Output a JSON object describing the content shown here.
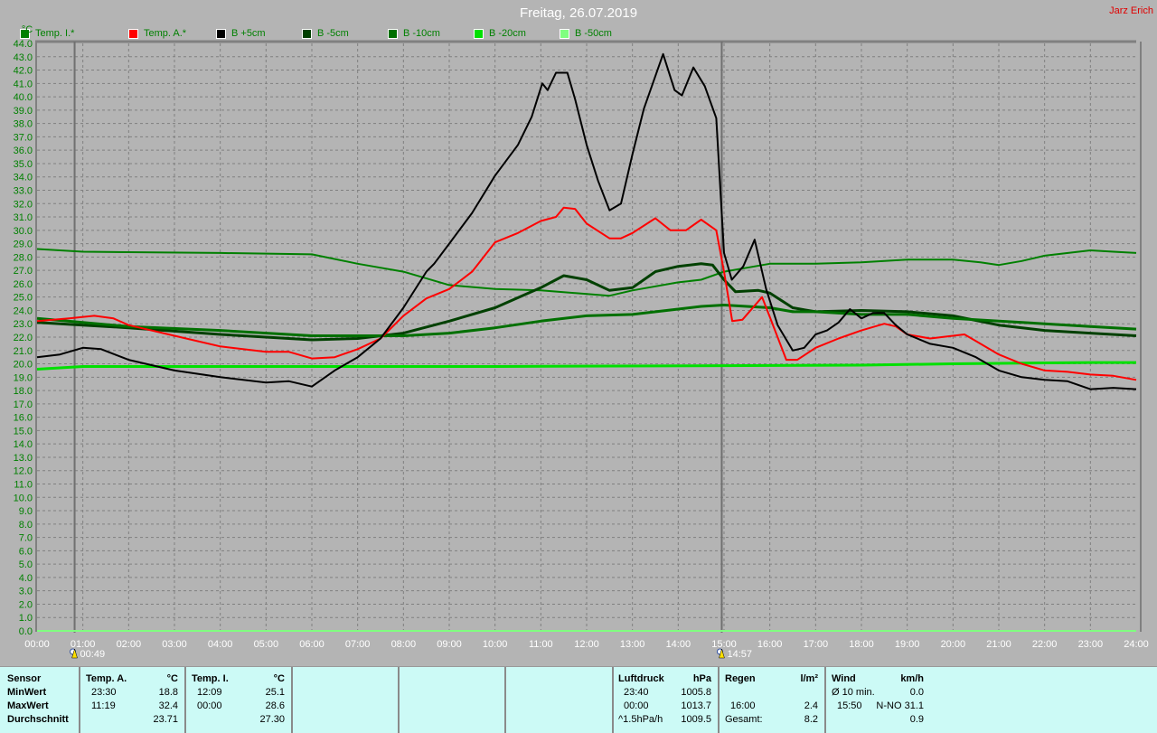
{
  "header": {
    "title": "Freitag, 26.07.2019",
    "author": "Jarz Erich"
  },
  "legend": [
    {
      "label": "Temp. I.*",
      "color": "#008000"
    },
    {
      "label": "Temp. A.*",
      "color": "#ff0000"
    },
    {
      "label": "B +5cm",
      "color": "#000000"
    },
    {
      "label": "B -5cm",
      "color": "#004000"
    },
    {
      "label": "B -10cm",
      "color": "#007000"
    },
    {
      "label": "B -20cm",
      "color": "#00e000"
    },
    {
      "label": "B -50cm",
      "color": "#80ff80"
    }
  ],
  "chart_data": {
    "type": "line",
    "ylabel": "°C",
    "ylim": [
      0,
      44
    ],
    "xlim": [
      0,
      24
    ],
    "grid": true,
    "yticks": [
      "0.0",
      "1.0",
      "2.0",
      "3.0",
      "4.0",
      "5.0",
      "6.0",
      "7.0",
      "8.0",
      "9.0",
      "10.0",
      "11.0",
      "12.0",
      "13.0",
      "14.0",
      "15.0",
      "16.0",
      "17.0",
      "18.0",
      "19.0",
      "20.0",
      "21.0",
      "22.0",
      "23.0",
      "24.0",
      "25.0",
      "26.0",
      "27.0",
      "28.0",
      "29.0",
      "30.0",
      "31.0",
      "32.0",
      "33.0",
      "34.0",
      "35.0",
      "36.0",
      "37.0",
      "38.0",
      "39.0",
      "40.0",
      "41.0",
      "42.0",
      "43.0",
      "44.0"
    ],
    "xticks": [
      "00:00",
      "01:00",
      "02:00",
      "03:00",
      "04:00",
      "05:00",
      "06:00",
      "07:00",
      "08:00",
      "09:00",
      "10:00",
      "11:00",
      "12:00",
      "13:00",
      "14:00",
      "15:00",
      "16:00",
      "17:00",
      "18:00",
      "19:00",
      "20:00",
      "21:00",
      "22:00",
      "23:00",
      "24:00"
    ],
    "markers": [
      {
        "label": "00:49",
        "hour": 0.82,
        "icon": "sunrise-icon"
      },
      {
        "label": "14:57",
        "hour": 14.95,
        "icon": "sunset-icon"
      }
    ],
    "series": [
      {
        "name": "Temp. I.*",
        "color": "#008000",
        "width": 2,
        "points": [
          [
            0,
            28.6
          ],
          [
            1,
            28.4
          ],
          [
            4,
            28.3
          ],
          [
            6,
            28.2
          ],
          [
            7,
            27.5
          ],
          [
            8,
            26.9
          ],
          [
            9,
            25.9
          ],
          [
            10,
            25.6
          ],
          [
            11,
            25.5
          ],
          [
            12.5,
            25.1
          ],
          [
            13,
            25.5
          ],
          [
            14,
            26.1
          ],
          [
            14.5,
            26.3
          ],
          [
            15,
            26.9
          ],
          [
            16,
            27.5
          ],
          [
            17,
            27.5
          ],
          [
            18,
            27.6
          ],
          [
            19,
            27.8
          ],
          [
            20,
            27.8
          ],
          [
            20.6,
            27.6
          ],
          [
            21,
            27.4
          ],
          [
            21.5,
            27.7
          ],
          [
            22,
            28.1
          ],
          [
            23,
            28.5
          ],
          [
            23.5,
            28.4
          ],
          [
            24,
            28.3
          ]
        ]
      },
      {
        "name": "B -5cm",
        "color": "#004000",
        "width": 3,
        "points": [
          [
            0,
            23.1
          ],
          [
            2,
            22.7
          ],
          [
            4,
            22.2
          ],
          [
            6,
            21.8
          ],
          [
            7,
            21.9
          ],
          [
            8,
            22.3
          ],
          [
            9,
            23.2
          ],
          [
            10,
            24.2
          ],
          [
            11,
            25.7
          ],
          [
            11.5,
            26.6
          ],
          [
            12,
            26.3
          ],
          [
            12.5,
            25.5
          ],
          [
            13,
            25.7
          ],
          [
            13.5,
            26.9
          ],
          [
            14,
            27.3
          ],
          [
            14.5,
            27.5
          ],
          [
            14.75,
            27.4
          ],
          [
            15,
            26.3
          ],
          [
            15.25,
            25.4
          ],
          [
            15.75,
            25.5
          ],
          [
            16,
            25.3
          ],
          [
            16.5,
            24.2
          ],
          [
            17,
            23.9
          ],
          [
            18,
            24.0
          ],
          [
            19,
            23.9
          ],
          [
            20,
            23.6
          ],
          [
            21,
            22.9
          ],
          [
            22,
            22.5
          ],
          [
            23,
            22.3
          ],
          [
            24,
            22.1
          ]
        ]
      },
      {
        "name": "B -10cm",
        "color": "#007000",
        "width": 3,
        "points": [
          [
            0,
            23.4
          ],
          [
            2,
            22.8
          ],
          [
            4,
            22.5
          ],
          [
            6,
            22.1
          ],
          [
            8,
            22.1
          ],
          [
            9,
            22.3
          ],
          [
            10,
            22.7
          ],
          [
            11,
            23.2
          ],
          [
            12,
            23.6
          ],
          [
            13,
            23.7
          ],
          [
            14,
            24.1
          ],
          [
            14.5,
            24.3
          ],
          [
            15,
            24.4
          ],
          [
            16,
            24.2
          ],
          [
            16.5,
            23.9
          ],
          [
            17,
            23.9
          ],
          [
            18,
            23.7
          ],
          [
            19,
            23.7
          ],
          [
            20,
            23.4
          ],
          [
            21,
            23.2
          ],
          [
            22,
            23.0
          ],
          [
            23,
            22.8
          ],
          [
            24,
            22.6
          ]
        ]
      },
      {
        "name": "B -20cm",
        "color": "#00e000",
        "width": 3,
        "points": [
          [
            0,
            19.6
          ],
          [
            1,
            19.8
          ],
          [
            10,
            19.8
          ],
          [
            18,
            19.9
          ],
          [
            20,
            20.0
          ],
          [
            23,
            20.1
          ],
          [
            24,
            20.1
          ]
        ]
      },
      {
        "name": "B -50cm",
        "color": "#80ff80",
        "width": 2,
        "points": [
          [
            0,
            0.0
          ],
          [
            24,
            0.0
          ]
        ]
      },
      {
        "name": "Temp. A.*",
        "color": "#ff0000",
        "width": 2,
        "points": [
          [
            0,
            23.2
          ],
          [
            0.7,
            23.4
          ],
          [
            1.25,
            23.6
          ],
          [
            1.67,
            23.4
          ],
          [
            2,
            22.9
          ],
          [
            3,
            22.1
          ],
          [
            4,
            21.3
          ],
          [
            5,
            20.9
          ],
          [
            5.5,
            20.9
          ],
          [
            6,
            20.4
          ],
          [
            6.5,
            20.5
          ],
          [
            7,
            21.1
          ],
          [
            7.5,
            21.9
          ],
          [
            8,
            23.6
          ],
          [
            8.5,
            24.9
          ],
          [
            9,
            25.6
          ],
          [
            9.5,
            26.9
          ],
          [
            10,
            29.1
          ],
          [
            10.5,
            29.8
          ],
          [
            11,
            30.7
          ],
          [
            11.33,
            31.0
          ],
          [
            11.5,
            31.7
          ],
          [
            11.75,
            31.6
          ],
          [
            12,
            30.5
          ],
          [
            12.5,
            29.4
          ],
          [
            12.75,
            29.4
          ],
          [
            13,
            29.8
          ],
          [
            13.5,
            30.9
          ],
          [
            13.83,
            30.0
          ],
          [
            14.17,
            30.0
          ],
          [
            14.5,
            30.8
          ],
          [
            14.83,
            30.0
          ],
          [
            15,
            26.9
          ],
          [
            15.18,
            23.2
          ],
          [
            15.4,
            23.3
          ],
          [
            15.83,
            25.0
          ],
          [
            16,
            23.5
          ],
          [
            16.36,
            20.3
          ],
          [
            16.6,
            20.3
          ],
          [
            17,
            21.2
          ],
          [
            17.5,
            21.9
          ],
          [
            18,
            22.5
          ],
          [
            18.5,
            23.0
          ],
          [
            18.75,
            22.8
          ],
          [
            19,
            22.2
          ],
          [
            19.5,
            21.9
          ],
          [
            20,
            22.1
          ],
          [
            20.25,
            22.2
          ],
          [
            20.5,
            21.7
          ],
          [
            21,
            20.7
          ],
          [
            21.5,
            20.0
          ],
          [
            22,
            19.5
          ],
          [
            22.5,
            19.4
          ],
          [
            23,
            19.2
          ],
          [
            23.5,
            19.1
          ],
          [
            24,
            18.8
          ]
        ]
      },
      {
        "name": "B +5cm",
        "color": "#000000",
        "width": 2,
        "points": [
          [
            0,
            20.5
          ],
          [
            0.5,
            20.7
          ],
          [
            1,
            21.2
          ],
          [
            1.4,
            21.1
          ],
          [
            2,
            20.3
          ],
          [
            3,
            19.5
          ],
          [
            4,
            19.0
          ],
          [
            5,
            18.6
          ],
          [
            5.5,
            18.7
          ],
          [
            6,
            18.3
          ],
          [
            6.5,
            19.5
          ],
          [
            7,
            20.5
          ],
          [
            7.5,
            21.9
          ],
          [
            8,
            24.2
          ],
          [
            8.5,
            26.9
          ],
          [
            8.67,
            27.5
          ],
          [
            9,
            29.0
          ],
          [
            9.5,
            31.3
          ],
          [
            10,
            34.1
          ],
          [
            10.5,
            36.4
          ],
          [
            10.8,
            38.5
          ],
          [
            11.03,
            41.0
          ],
          [
            11.15,
            40.5
          ],
          [
            11.33,
            41.8
          ],
          [
            11.58,
            41.8
          ],
          [
            11.75,
            39.8
          ],
          [
            12,
            36.4
          ],
          [
            12.25,
            33.7
          ],
          [
            12.5,
            31.5
          ],
          [
            12.75,
            32.0
          ],
          [
            13,
            35.7
          ],
          [
            13.25,
            39.1
          ],
          [
            13.67,
            43.2
          ],
          [
            13.92,
            40.5
          ],
          [
            14.08,
            40.1
          ],
          [
            14.33,
            42.2
          ],
          [
            14.58,
            40.8
          ],
          [
            14.83,
            38.4
          ],
          [
            15,
            28.3
          ],
          [
            15.17,
            26.3
          ],
          [
            15.42,
            27.3
          ],
          [
            15.67,
            29.3
          ],
          [
            15.92,
            25.6
          ],
          [
            16.17,
            22.9
          ],
          [
            16.5,
            21.0
          ],
          [
            16.75,
            21.2
          ],
          [
            17,
            22.2
          ],
          [
            17.25,
            22.5
          ],
          [
            17.5,
            23.1
          ],
          [
            17.75,
            24.1
          ],
          [
            18,
            23.4
          ],
          [
            18.25,
            23.8
          ],
          [
            18.5,
            23.8
          ],
          [
            18.75,
            22.9
          ],
          [
            19,
            22.2
          ],
          [
            19.5,
            21.5
          ],
          [
            20,
            21.2
          ],
          [
            20.5,
            20.5
          ],
          [
            21,
            19.5
          ],
          [
            21.5,
            19.0
          ],
          [
            22,
            18.8
          ],
          [
            22.5,
            18.7
          ],
          [
            23,
            18.1
          ],
          [
            23.5,
            18.2
          ],
          [
            24,
            18.1
          ]
        ]
      }
    ]
  },
  "stats": {
    "sensor": {
      "header": "Sensor",
      "min": "MinWert",
      "max": "MaxWert",
      "avg": "Durchschnitt"
    },
    "temp_a": {
      "header": "Temp. A.",
      "unit": "°C",
      "min_time": "23:30",
      "min": "18.8",
      "max_time": "11:19",
      "max": "32.4",
      "avg": "23.71"
    },
    "temp_i": {
      "header": "Temp. I.",
      "unit": "°C",
      "min_time": "12:09",
      "min": "25.1",
      "max_time": "00:00",
      "max": "28.6",
      "avg": "27.30"
    },
    "pressure": {
      "header": "Luftdruck",
      "unit": "hPa",
      "min_time": "23:40",
      "min": "1005.8",
      "max_time": "00:00",
      "max": "1013.7",
      "trend": "^1.5hPa/h",
      "avg": "1009.5"
    },
    "rain": {
      "header": "Regen",
      "unit": "l/m²",
      "max_time": "16:00",
      "max": "2.4",
      "total_label": "Gesamt:",
      "total": "8.2"
    },
    "wind": {
      "header": "Wind",
      "unit": "km/h",
      "avg10_label": "Ø 10 min.",
      "avg10": "0.0",
      "max_time": "15:50",
      "max": "N-NO 31.1",
      "avg": "0.9"
    }
  }
}
